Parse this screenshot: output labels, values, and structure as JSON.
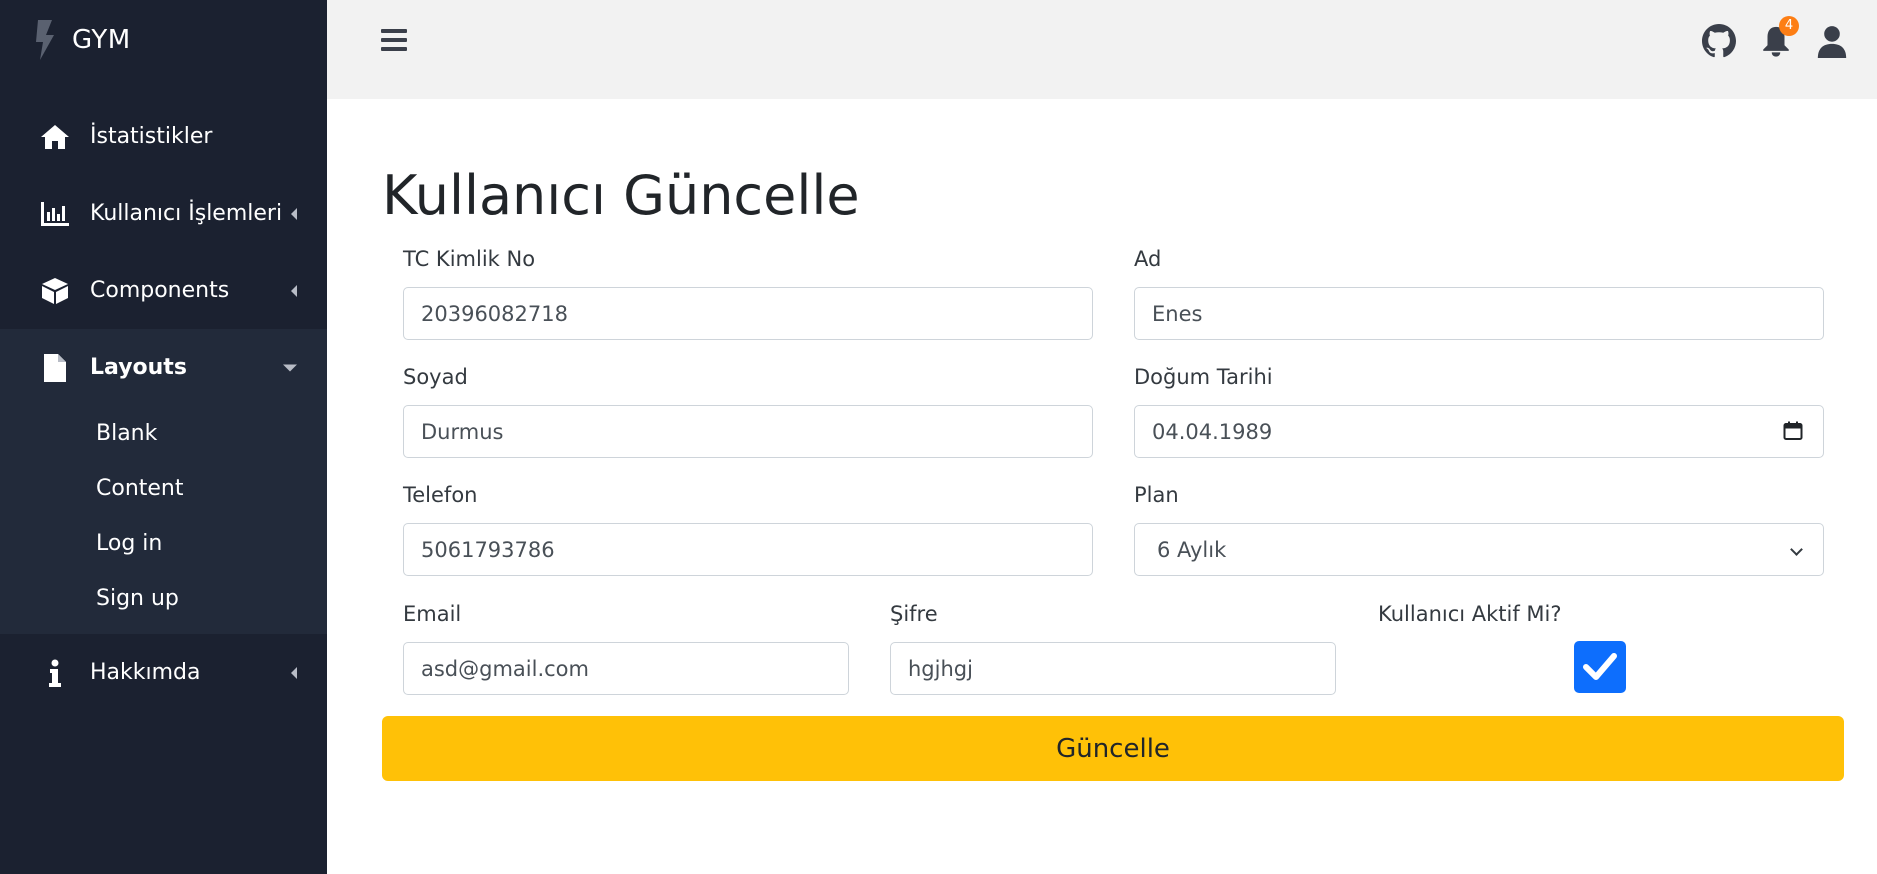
{
  "brand": {
    "name": "GYM"
  },
  "sidebar": {
    "items": [
      {
        "label": "İstatistikler",
        "icon": "home-icon"
      },
      {
        "label": "Kullanıcı İşlemleri",
        "icon": "chart-bar-icon"
      },
      {
        "label": "Components",
        "icon": "cube-icon"
      },
      {
        "label": "Layouts",
        "icon": "file-icon",
        "expanded": true
      },
      {
        "label": "Hakkımda",
        "icon": "info-icon"
      }
    ],
    "layouts_subitems": [
      "Blank",
      "Content",
      "Log in",
      "Sign up"
    ]
  },
  "topbar": {
    "notification_count": "4",
    "icons": [
      "menu-icon",
      "github-icon",
      "bell-icon",
      "user-icon"
    ]
  },
  "form": {
    "title": "Kullanıcı Güncelle",
    "tc": {
      "label": "TC Kimlik No",
      "value": "20396082718"
    },
    "ad": {
      "label": "Ad",
      "value": "Enes"
    },
    "soyad": {
      "label": "Soyad",
      "value": "Durmus"
    },
    "dogum": {
      "label": "Doğum Tarihi",
      "value": "04.04.1989"
    },
    "telefon": {
      "label": "Telefon",
      "value": "5061793786"
    },
    "plan": {
      "label": "Plan",
      "value": "6 Aylık"
    },
    "email": {
      "label": "Email",
      "value": "asd@gmail.com"
    },
    "sifre": {
      "label": "Şifre",
      "value": "hgjhgj"
    },
    "aktif": {
      "label": "Kullanıcı Aktif Mi?",
      "checked": true
    },
    "submit_label": "Güncelle"
  },
  "colors": {
    "sidebar_bg": "#1b2130",
    "topbar_bg": "#f2f2f2",
    "submit_bg": "#ffc107",
    "checkbox_bg": "#0d6efd",
    "badge_bg": "#fd7e14"
  }
}
